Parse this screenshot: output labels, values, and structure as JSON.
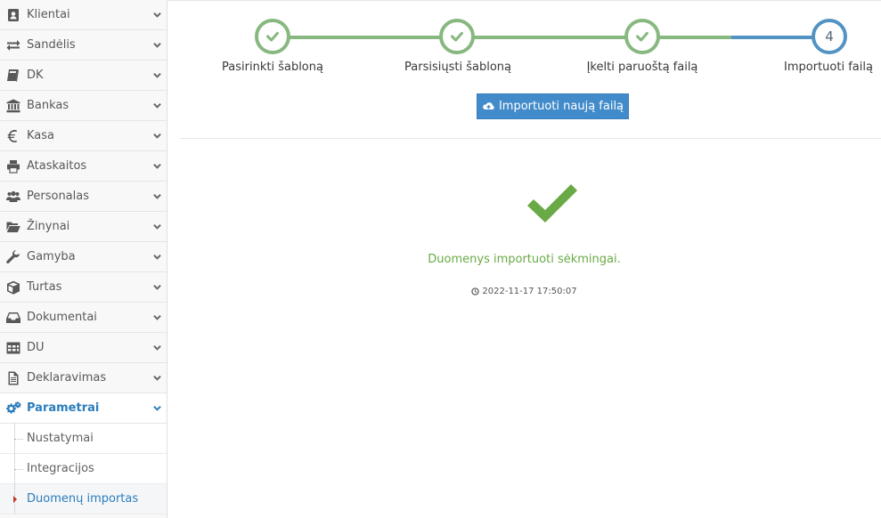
{
  "sidebar": {
    "items": [
      {
        "label": "Klientai",
        "icon": "address-book-icon"
      },
      {
        "label": "Sandėlis",
        "icon": "exchange-arrows-icon"
      },
      {
        "label": "DK",
        "icon": "book-icon"
      },
      {
        "label": "Bankas",
        "icon": "bank-icon"
      },
      {
        "label": "Kasa",
        "icon": "euro-icon"
      },
      {
        "label": "Ataskaitos",
        "icon": "printer-icon"
      },
      {
        "label": "Personalas",
        "icon": "users-icon"
      },
      {
        "label": "Žinynai",
        "icon": "folder-open-icon"
      },
      {
        "label": "Gamyba",
        "icon": "wrench-icon"
      },
      {
        "label": "Turtas",
        "icon": "cube-icon"
      },
      {
        "label": "Dokumentai",
        "icon": "inbox-icon"
      },
      {
        "label": "DU",
        "icon": "table-icon"
      },
      {
        "label": "Deklaravimas",
        "icon": "file-text-icon"
      },
      {
        "label": "Parametrai",
        "icon": "gears-icon",
        "active": true
      }
    ],
    "subitems": [
      {
        "label": "Nustatymai"
      },
      {
        "label": "Integracijos"
      },
      {
        "label": "Duomenų importas",
        "active": true
      }
    ]
  },
  "wizard": {
    "steps": [
      {
        "title": "Pasirinkti šabloną",
        "state": "done"
      },
      {
        "title": "Parsisiųsti šabloną",
        "state": "done"
      },
      {
        "title": "Įkelti paruoštą failą",
        "state": "done"
      },
      {
        "title": "Importuoti failą",
        "state": "current",
        "number": "4"
      }
    ]
  },
  "actions": {
    "import_new_label": "Importuoti naują failą"
  },
  "result": {
    "message": "Duomenys importuoti sėkmingai.",
    "timestamp": "2022-11-17 17:50:07"
  },
  "colors": {
    "accent": "#2b7dbc",
    "success": "#69aa46",
    "step_done": "#87b87f",
    "step_current": "#5293c4",
    "button": "#428bca"
  }
}
